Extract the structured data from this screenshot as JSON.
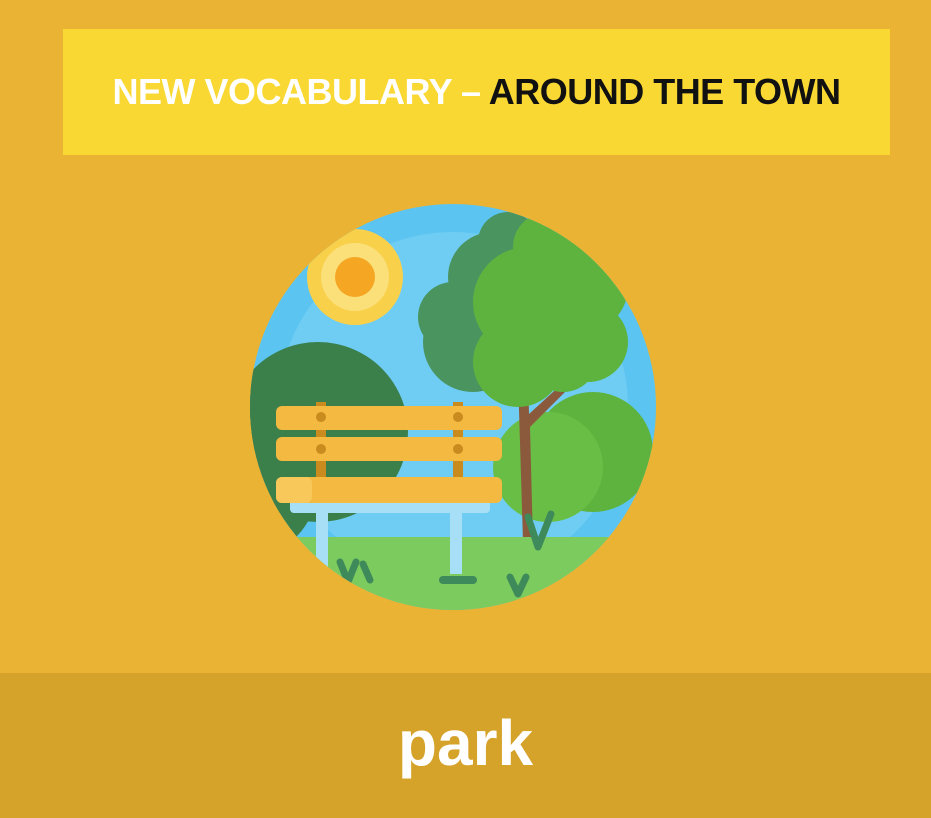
{
  "header": {
    "lead": "NEW VOCABULARY",
    "dash": "–",
    "tail": "AROUND THE TOWN"
  },
  "illustration": {
    "icon": "park-bench-icon"
  },
  "word": {
    "label": "park"
  },
  "colors": {
    "background": "#EBB333",
    "banner": "#F9D833",
    "word_band": "#D6A32A",
    "sky": "#5BC4F1",
    "grass": "#7CCB5E",
    "tree_light": "#5DB33E",
    "tree_dark": "#3F8A5A",
    "bench": "#F4B941",
    "sun": "#F8D04A"
  }
}
